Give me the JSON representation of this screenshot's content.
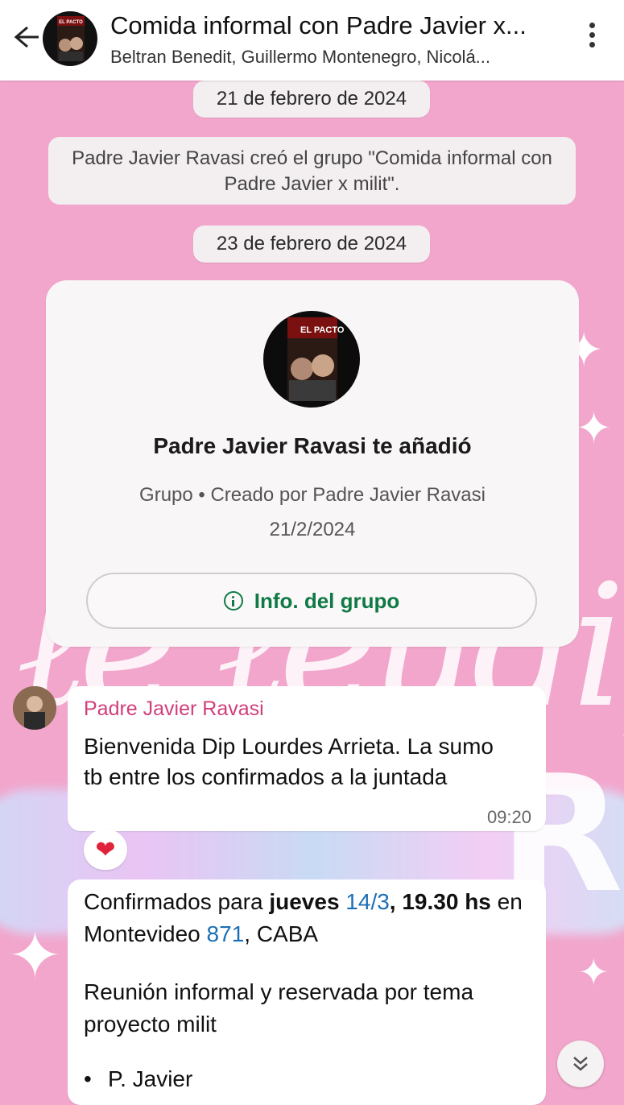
{
  "header": {
    "title": "Comida informal con Padre Javier x...",
    "subtitle": "Beltran Benedit, Guillermo Montenegro, Nicolá...",
    "avatar_text": "EL PACTO"
  },
  "chat": {
    "date1": "21 de febrero de 2024",
    "system_message": "Padre Javier Ravasi creó el grupo \"Comida informal con Padre Javier x milit\".",
    "date2": "23 de febrero de 2024",
    "group_card": {
      "avatar_text": "EL PACTO",
      "title": "Padre Javier Ravasi te añadió",
      "subtitle_line1": "Grupo • Creado por Padre Javier Ravasi",
      "subtitle_line2": "21/2/2024",
      "button_label": "Info. del grupo"
    },
    "message1": {
      "sender": "Padre Javier Ravasi",
      "text": "Bienvenida Dip Lourdes Arrieta. La sumo tb entre los confirmados a la juntada",
      "time": "09:20",
      "reaction": "❤"
    },
    "message2": {
      "t1": "Confirmados para ",
      "t2": "jueves ",
      "t3": "14/3",
      "t4": ", 19.30 hs",
      "t5": " en Montevideo ",
      "t6": "871",
      "t7": ", CABA",
      "paragraph2": "Reunión informal y reservada por tema proyecto milit",
      "bullet1": "P. Javier"
    }
  },
  "colors": {
    "wallpaper": "#f2a6cc",
    "sender_name": "#d13f7a",
    "group_button": "#0f7a45",
    "link": "#1b6fb6"
  },
  "icons": [
    "back-arrow-icon",
    "more-vert-icon",
    "info-icon",
    "heart-icon",
    "double-chevron-down-icon"
  ]
}
